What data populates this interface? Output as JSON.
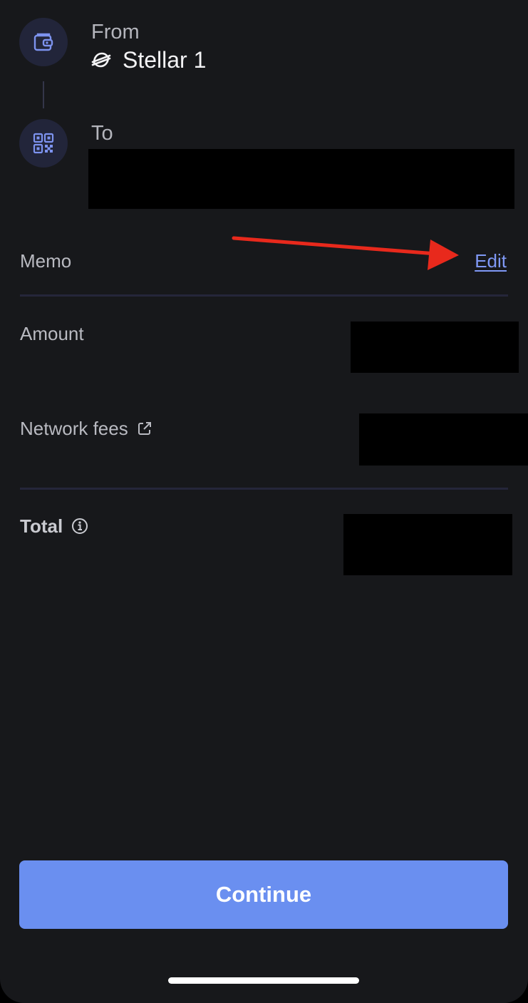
{
  "transfer": {
    "from_label": "From",
    "from_account": "Stellar 1",
    "to_label": "To"
  },
  "details": {
    "memo_label": "Memo",
    "memo_action": "Edit",
    "amount_label": "Amount",
    "network_fees_label": "Network fees",
    "total_label": "Total"
  },
  "actions": {
    "continue_label": "Continue"
  },
  "icons": {
    "from": "wallet-icon",
    "account": "stellar-logo-icon",
    "to": "qr-code-icon",
    "fees": "external-link-icon",
    "total": "info-icon"
  },
  "colors": {
    "background": "#17181b",
    "accent": "#6a8ff0",
    "link": "#7f98f5",
    "annotation_arrow": "#e8291c"
  }
}
